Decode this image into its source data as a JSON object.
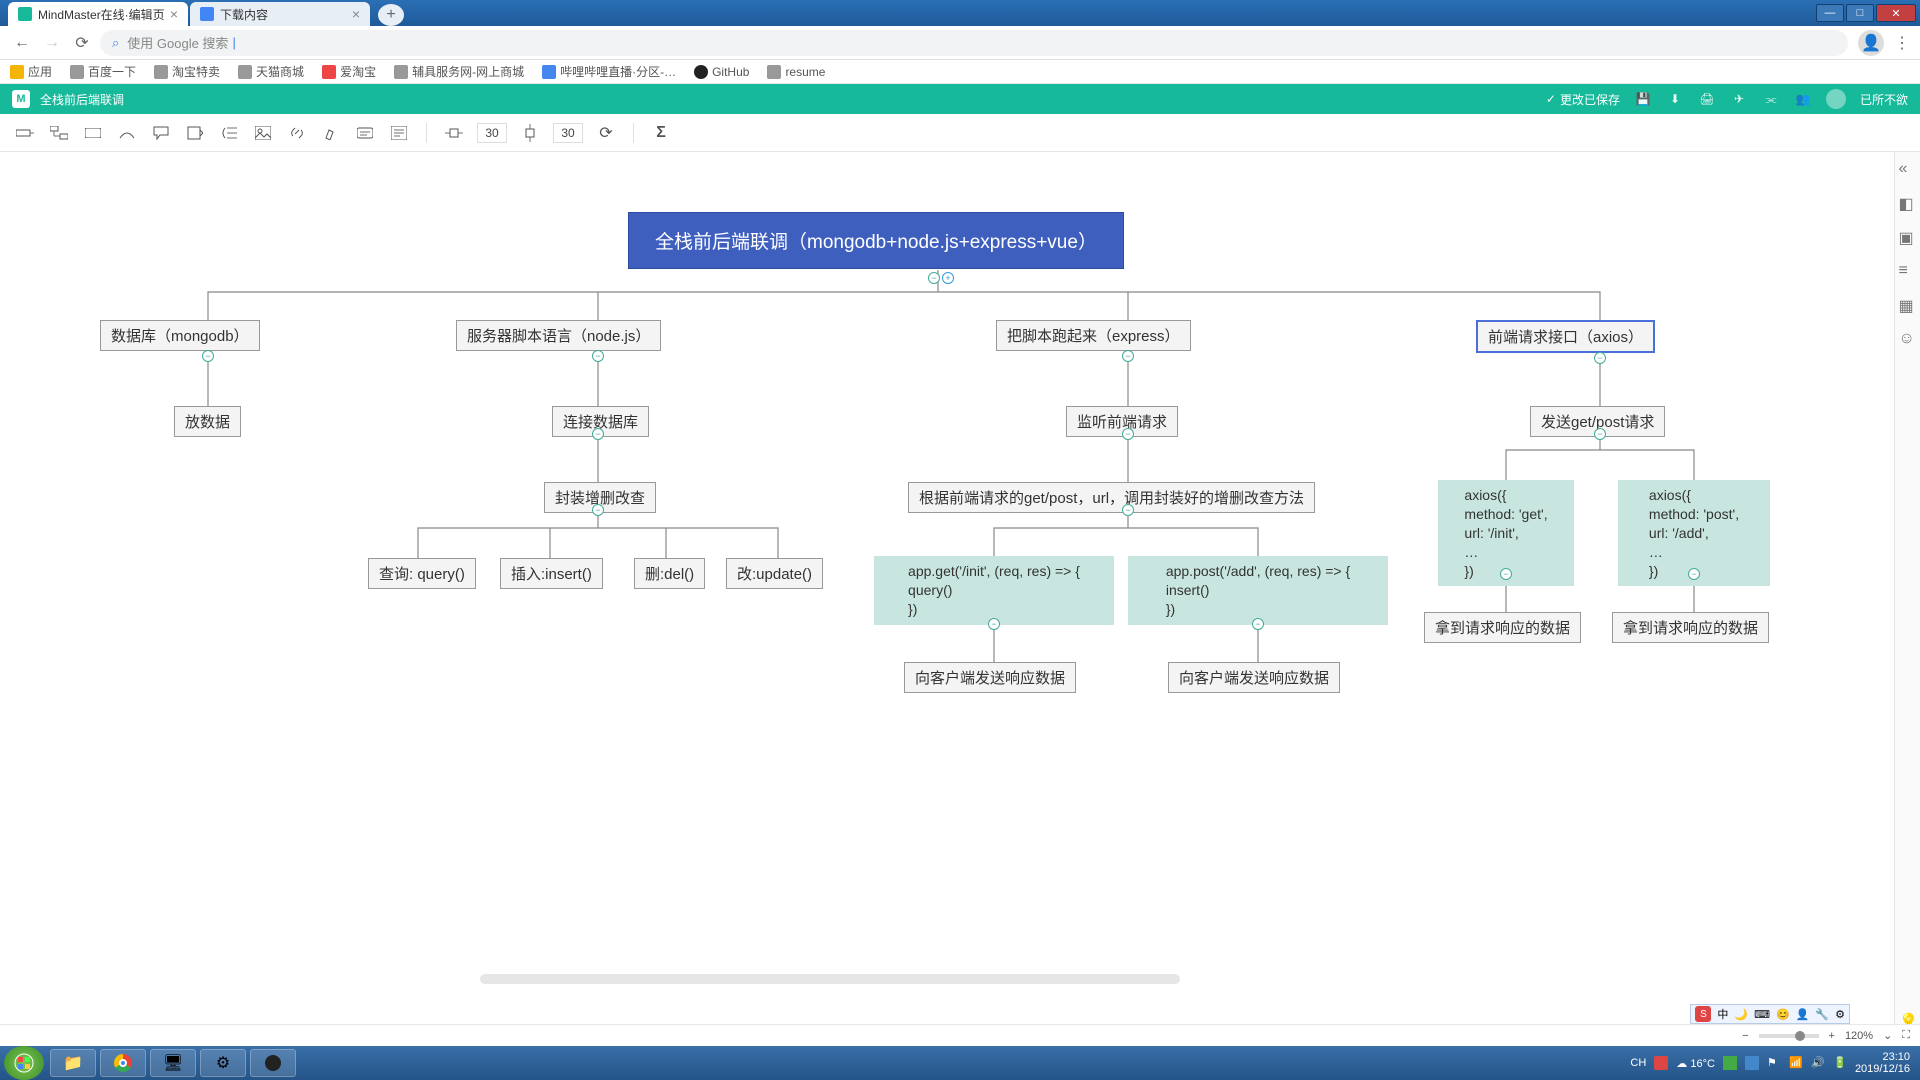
{
  "win": {
    "minimize": "—",
    "maximize": "□",
    "close": "✕"
  },
  "tabs": {
    "t1": "MindMaster在线·编辑页",
    "t2": "下载内容",
    "newtab": "+"
  },
  "url": {
    "placeholder": "使用 Google 搜索"
  },
  "bookmarks": {
    "apps": "应用",
    "b1": "百度一下",
    "b2": "淘宝特卖",
    "b3": "天猫商城",
    "b4": "爱淘宝",
    "b5": "辅具服务网-网上商城",
    "b6": "哔哩哔哩直播·分区-…",
    "b7": "GitHub",
    "b8": "resume"
  },
  "app": {
    "title": "全栈前后端联调",
    "save_status": "更改已保存",
    "user": "已所不欲"
  },
  "toolbar": {
    "gap1": "30",
    "gap2": "30"
  },
  "nodes": {
    "root": "全栈前后端联调（mongodb+node.js+express+vue）",
    "db": "数据库（mongodb）",
    "db_c1": "放数据",
    "srv": "服务器脚本语言（node.js）",
    "srv_c1": "连接数据库",
    "srv_c2": "封装增删改查",
    "srv_l1": "查询: query()",
    "srv_l2": "插入:insert()",
    "srv_l3": "删:del()",
    "srv_l4": "改:update()",
    "exp": "把脚本跑起来（express）",
    "exp_c1": "监听前端请求",
    "exp_c2": "根据前端请求的get/post，url，调用封装好的增删改查方法",
    "exp_l1": "app.get('/init', (req, res) => {\n    query()\n})",
    "exp_l2": "app.post('/add', (req, res) => {\n    insert()\n})",
    "exp_r1": "向客户端发送响应数据",
    "exp_r2": "向客户端发送响应数据",
    "ax": "前端请求接口（axios）",
    "ax_c1": "发送get/post请求",
    "ax_l1": "axios({\n    method: 'get',\n    url: '/init',\n    …\n})",
    "ax_l2": "axios({\n    method: 'post',\n    url: '/add',\n    …\n})",
    "ax_r1": "拿到请求响应的数据",
    "ax_r2": "拿到请求响应的数据"
  },
  "status": {
    "zoom": "120%"
  },
  "ime": {
    "lang": "中"
  },
  "tray": {
    "kb": "CH",
    "temp": "16°C",
    "time": "23:10",
    "date": "2019/12/16"
  }
}
